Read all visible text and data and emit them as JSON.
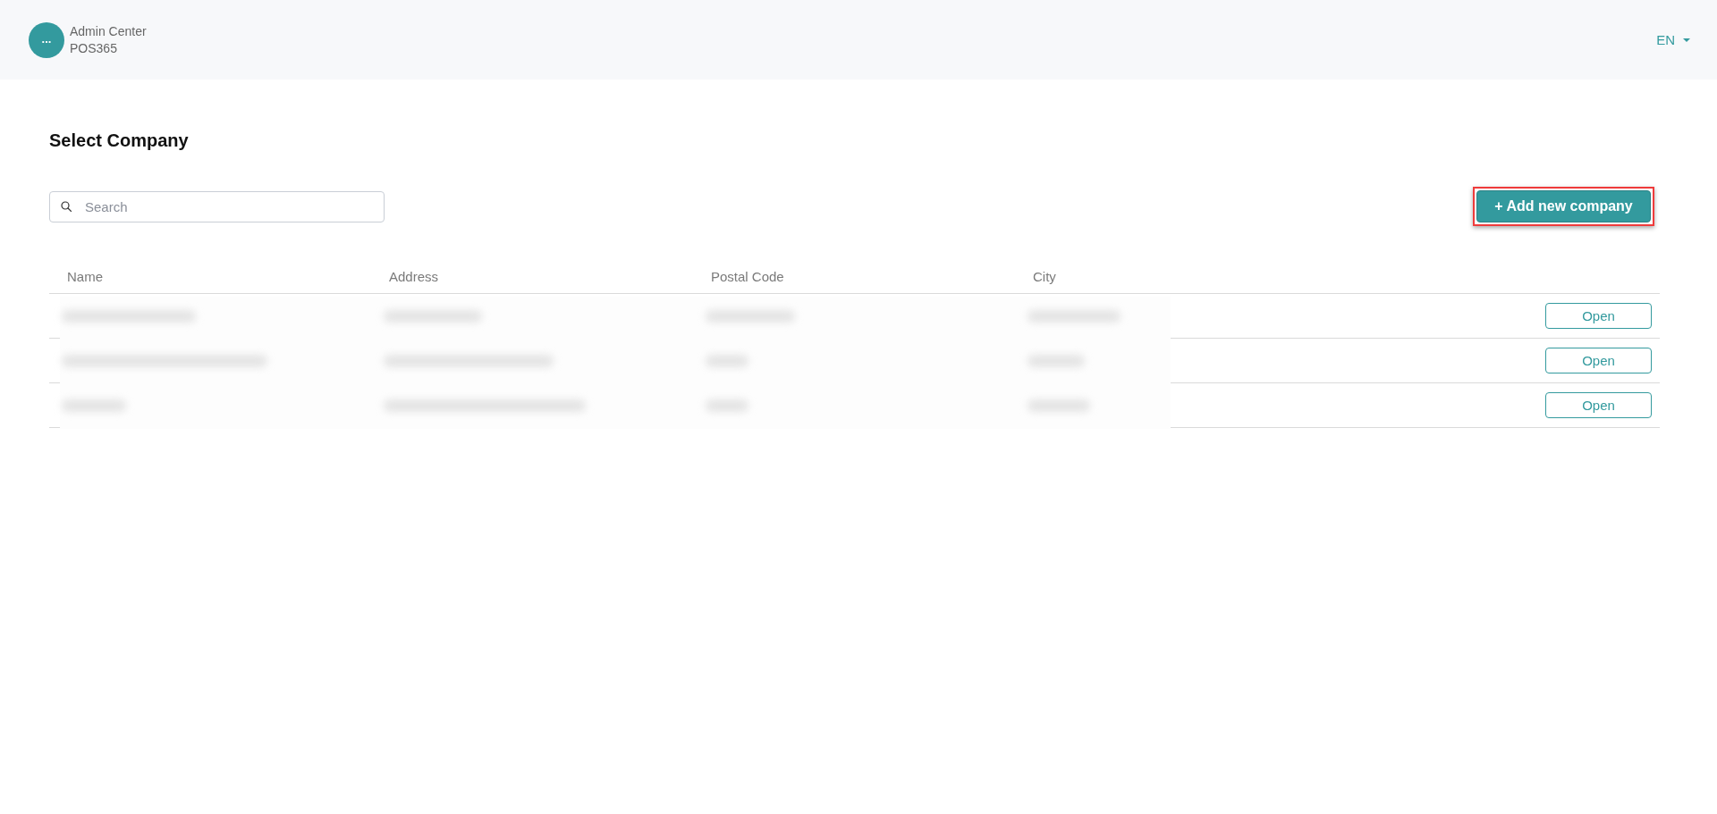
{
  "header": {
    "avatar_label": "...",
    "app_name": "Admin Center",
    "tenant": "POS365",
    "language": "EN"
  },
  "page": {
    "title": "Select Company"
  },
  "search": {
    "placeholder": "Search"
  },
  "add_button": {
    "label": "+ Add new company",
    "highlighted": true
  },
  "table": {
    "columns": [
      "Name",
      "Address",
      "Postal Code",
      "City"
    ],
    "rows": [
      {
        "action": "Open"
      },
      {
        "action": "Open"
      },
      {
        "action": "Open"
      }
    ]
  }
}
